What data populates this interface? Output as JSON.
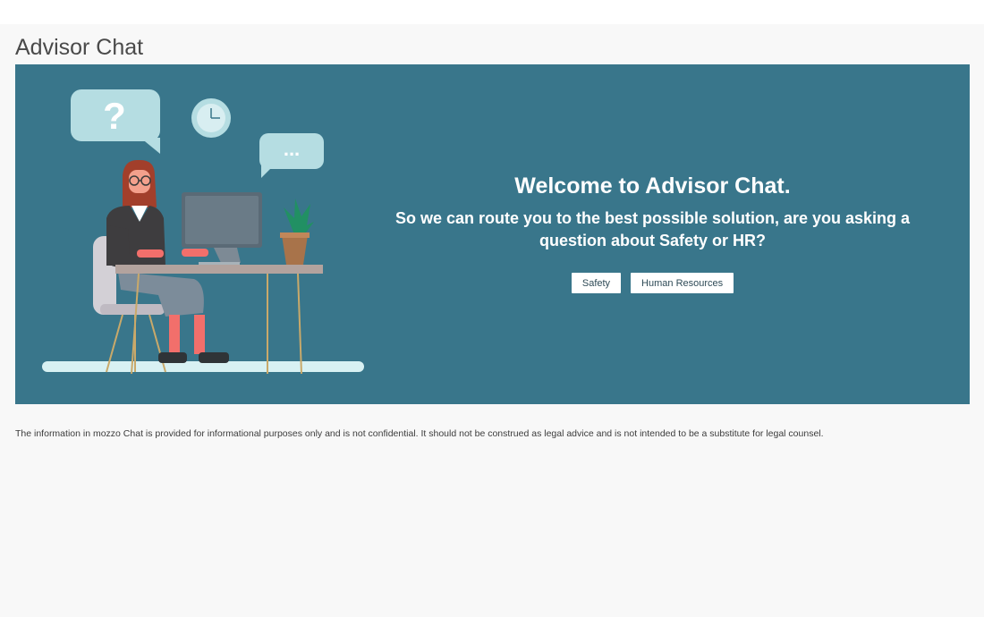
{
  "page": {
    "title": "Advisor Chat"
  },
  "banner": {
    "welcome_title": "Welcome to Advisor Chat.",
    "welcome_question": "So we can route you to the best possible solution, are you asking a question about Safety or HR?",
    "buttons": [
      {
        "label": "Safety"
      },
      {
        "label": "Human Resources"
      }
    ],
    "illustration": {
      "question_bubble_text": "?",
      "dots_bubble_text": "..."
    },
    "colors": {
      "background": "#39768b",
      "bubble": "#b5dde2",
      "button_bg": "#ffffff",
      "button_text": "#2e4a56"
    }
  },
  "footer": {
    "disclaimer": "The information in mozzo Chat is provided for informational purposes only and is not confidential. It should not be construed as legal advice and is not intended to be a substitute for legal counsel."
  }
}
